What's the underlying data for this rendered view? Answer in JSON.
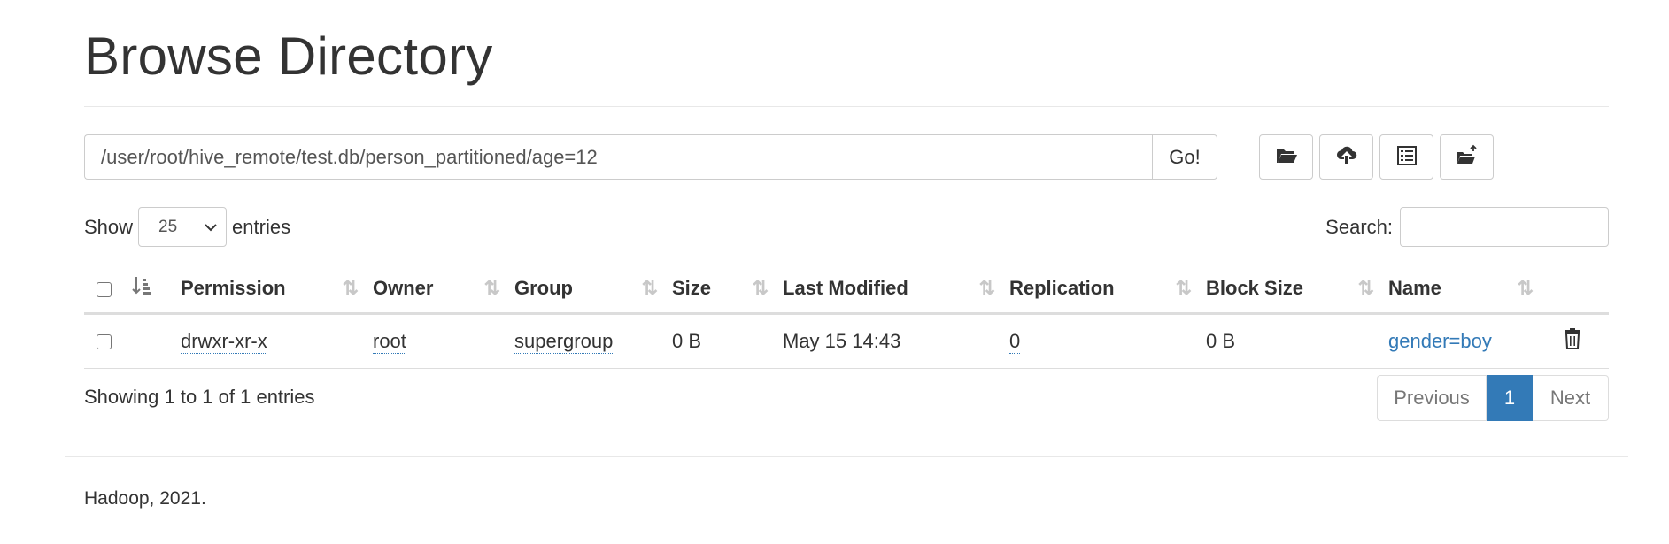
{
  "page": {
    "title": "Browse Directory"
  },
  "path_bar": {
    "value": "/user/root/hive_remote/test.db/person_partitioned/age=12",
    "go_label": "Go!"
  },
  "toolbar": {
    "buttons": [
      {
        "icon": "folder-open-icon"
      },
      {
        "icon": "cloud-upload-icon"
      },
      {
        "icon": "list-alt-icon"
      },
      {
        "icon": "move-folder-icon"
      }
    ]
  },
  "table_controls": {
    "show_label": "Show",
    "entries_value": "25",
    "entries_label": "entries",
    "search_label": "Search:"
  },
  "table": {
    "columns": [
      "Permission",
      "Owner",
      "Group",
      "Size",
      "Last Modified",
      "Replication",
      "Block Size",
      "Name"
    ],
    "rows": [
      {
        "permission": "drwxr-xr-x",
        "owner": "root",
        "group": "supergroup",
        "size": "0 B",
        "last_modified": "May 15 14:43",
        "replication": "0",
        "block_size": "0 B",
        "name": "gender=boy"
      }
    ]
  },
  "info": "Showing 1 to 1 of 1 entries",
  "pagination": {
    "previous": "Previous",
    "current": "1",
    "next": "Next"
  },
  "footer": "Hadoop, 2021.",
  "colors": {
    "link": "#337ab7",
    "active_page": "#337ab7"
  }
}
